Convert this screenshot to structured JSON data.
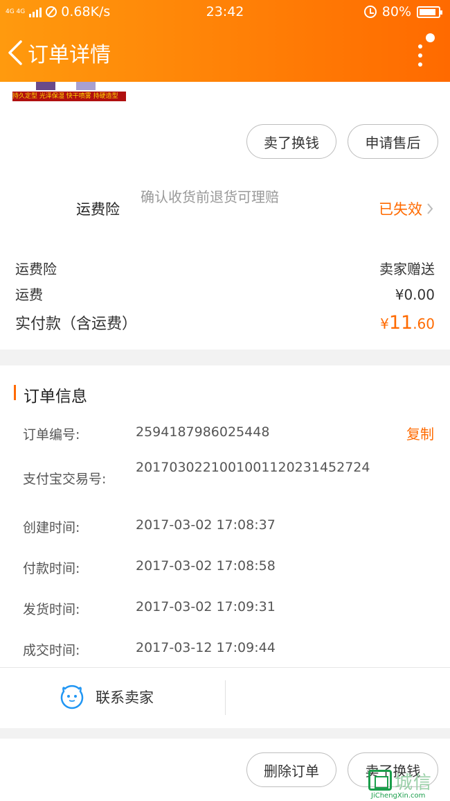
{
  "status_bar": {
    "network_type": "4G 4G",
    "speed": "0.68K/s",
    "time": "23:42",
    "battery": "80%"
  },
  "header": {
    "title": "订单详情"
  },
  "product_banner_text": "持久定型 光泽保湿 快干喷雾 持硬造型",
  "actions_top": {
    "sell_label": "卖了换钱",
    "after_sale_label": "申请售后"
  },
  "shipping_insurance": {
    "label": "运费险",
    "description": "确认收货前退货可理赔",
    "status": "已失效"
  },
  "costs": {
    "insurance_label": "运费险",
    "insurance_value": "卖家赠送",
    "shipping_label": "运费",
    "shipping_value": "¥0.00",
    "total_label": "实付款（含运费）",
    "total_currency": "¥",
    "total_int": "11",
    "total_dec": ".60"
  },
  "order_info": {
    "title": "订单信息",
    "copy_label": "复制",
    "rows": [
      {
        "label": "订单编号:",
        "value": "2594187986025448"
      },
      {
        "label": "支付宝交易号:",
        "value": "2017030221001001120231452724"
      },
      {
        "label": "创建时间:",
        "value": "2017-03-02 17:08:37"
      },
      {
        "label": "付款时间:",
        "value": "2017-03-02 17:08:58"
      },
      {
        "label": "发货时间:",
        "value": "2017-03-02 17:09:31"
      },
      {
        "label": "成交时间:",
        "value": "2017-03-12 17:09:44"
      }
    ]
  },
  "contact": {
    "label": "联系卖家"
  },
  "actions_bottom": {
    "delete_label": "删除订单",
    "sell_label": "卖了换钱"
  },
  "watermark": {
    "cn": "城信",
    "en": "JiChengXin.com"
  },
  "colors": {
    "accent": "#ff6a00",
    "header_start": "#ff9a0e",
    "header_end": "#ff6a00"
  }
}
